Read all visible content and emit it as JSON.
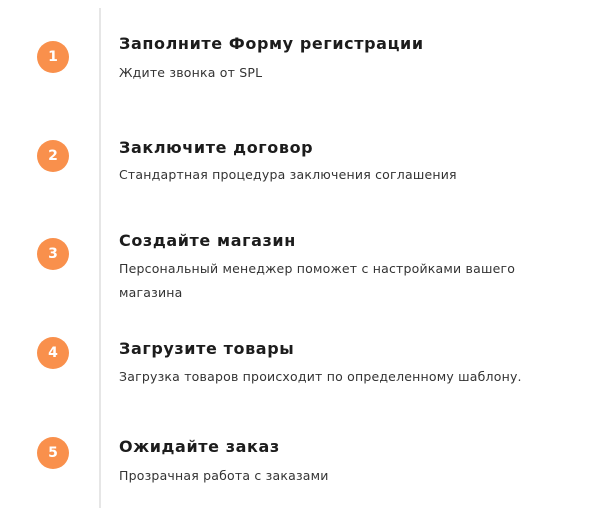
{
  "steps": [
    {
      "number": "1",
      "title": "Заполните Форму регистрации",
      "description": "Ждите звонка от SPL"
    },
    {
      "number": "2",
      "title": "Заключите договор",
      "description": "Стандартная процедура заключения соглашения"
    },
    {
      "number": "3",
      "title": "Создайте магазин",
      "description": "Персональный менеджер поможет с настройками вашего магазина"
    },
    {
      "number": "4",
      "title": "Загрузите товары",
      "description": "Загрузка товаров происходит по определенному шаблону."
    },
    {
      "number": "5",
      "title": "Ожидайте заказ",
      "description": "Прозрачная работа с заказами"
    }
  ],
  "colors": {
    "badge": "#f9904c",
    "timeline": "#e6e6e6"
  }
}
